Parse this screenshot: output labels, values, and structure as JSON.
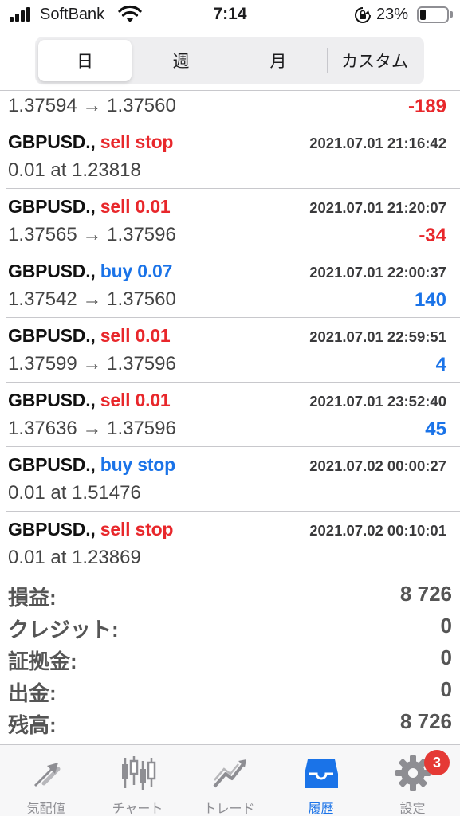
{
  "status_bar": {
    "carrier": "SoftBank",
    "time": "7:14",
    "battery_pct": "23%"
  },
  "period_tabs": [
    {
      "label": "日",
      "active": true
    },
    {
      "label": "週",
      "active": false
    },
    {
      "label": "月",
      "active": false
    },
    {
      "label": "カスタム",
      "active": false
    }
  ],
  "trades": [
    {
      "symbol": "",
      "type": "",
      "time": "",
      "prices": "1.37594 → 1.37560",
      "profit": "-189",
      "sign": "neg"
    },
    {
      "symbol": "GBPUSD., ",
      "type": "sell stop",
      "side": "sell",
      "time": "2021.07.01 21:16:42",
      "prices": "0.01 at 1.23818",
      "profit": "",
      "sign": ""
    },
    {
      "symbol": "GBPUSD., ",
      "type": "sell 0.01",
      "side": "sell",
      "time": "2021.07.01 21:20:07",
      "prices": "1.37565 → 1.37596",
      "profit": "-34",
      "sign": "neg"
    },
    {
      "symbol": "GBPUSD., ",
      "type": "buy 0.07",
      "side": "buy",
      "time": "2021.07.01 22:00:37",
      "prices": "1.37542 → 1.37560",
      "profit": "140",
      "sign": "pos"
    },
    {
      "symbol": "GBPUSD., ",
      "type": "sell 0.01",
      "side": "sell",
      "time": "2021.07.01 22:59:51",
      "prices": "1.37599 → 1.37596",
      "profit": "4",
      "sign": "pos"
    },
    {
      "symbol": "GBPUSD., ",
      "type": "sell 0.01",
      "side": "sell",
      "time": "2021.07.01 23:52:40",
      "prices": "1.37636 → 1.37596",
      "profit": "45",
      "sign": "pos"
    },
    {
      "symbol": "GBPUSD., ",
      "type": "buy stop",
      "side": "buy",
      "time": "2021.07.02 00:00:27",
      "prices": "0.01 at 1.51476",
      "profit": "",
      "sign": ""
    },
    {
      "symbol": "GBPUSD., ",
      "type": "sell stop",
      "side": "sell",
      "time": "2021.07.02 00:10:01",
      "prices": "0.01 at 1.23869",
      "profit": "",
      "sign": ""
    }
  ],
  "summary": [
    {
      "label": "損益:",
      "value": "8 726"
    },
    {
      "label": "クレジット:",
      "value": "0"
    },
    {
      "label": "証拠金:",
      "value": "0"
    },
    {
      "label": "出金:",
      "value": "0"
    },
    {
      "label": "残高:",
      "value": "8 726"
    }
  ],
  "tab_bar": [
    {
      "label": "気配値",
      "icon": "quotes-icon",
      "active": false
    },
    {
      "label": "チャート",
      "icon": "chart-icon",
      "active": false
    },
    {
      "label": "トレード",
      "icon": "trade-icon",
      "active": false
    },
    {
      "label": "履歴",
      "icon": "history-icon",
      "active": true
    },
    {
      "label": "設定",
      "icon": "settings-icon",
      "active": false
    }
  ],
  "settings_badge": "3",
  "colors": {
    "sell": "#e8272b",
    "buy": "#1a73e8",
    "active_tab": "#1a73e8",
    "badge": "#e53935"
  }
}
